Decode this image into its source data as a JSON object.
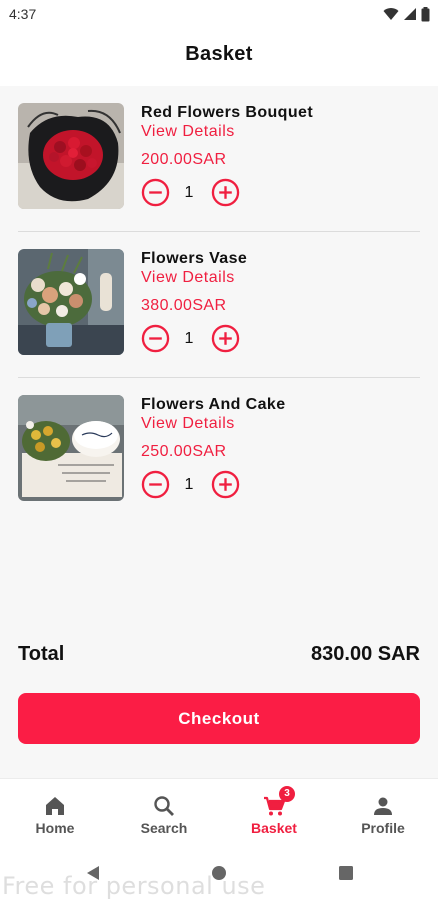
{
  "status_bar": {
    "time": "4:37"
  },
  "header": {
    "title": "Basket"
  },
  "items": [
    {
      "name": "Red Flowers Bouquet",
      "details_label": "View Details",
      "price": "200.00SAR",
      "quantity": "1",
      "image": "red-roses-bouquet"
    },
    {
      "name": "Flowers Vase",
      "details_label": "View Details",
      "price": "380.00SAR",
      "quantity": "1",
      "image": "flowers-vase"
    },
    {
      "name": "Flowers And Cake",
      "details_label": "View Details",
      "price": "250.00SAR",
      "quantity": "1",
      "image": "flowers-and-cake"
    }
  ],
  "summary": {
    "total_label": "Total",
    "total_value": "830.00 SAR"
  },
  "checkout": {
    "label": "Checkout"
  },
  "bottom_nav": {
    "items": [
      {
        "label": "Home",
        "icon": "home-icon"
      },
      {
        "label": "Search",
        "icon": "search-icon"
      },
      {
        "label": "Basket",
        "icon": "cart-icon",
        "badge": "3",
        "active": true
      },
      {
        "label": "Profile",
        "icon": "person-icon"
      }
    ]
  },
  "watermark": "Free for personal use",
  "colors": {
    "accent": "#f01f40",
    "button": "#fb1d45",
    "background": "#f7f7f7"
  }
}
